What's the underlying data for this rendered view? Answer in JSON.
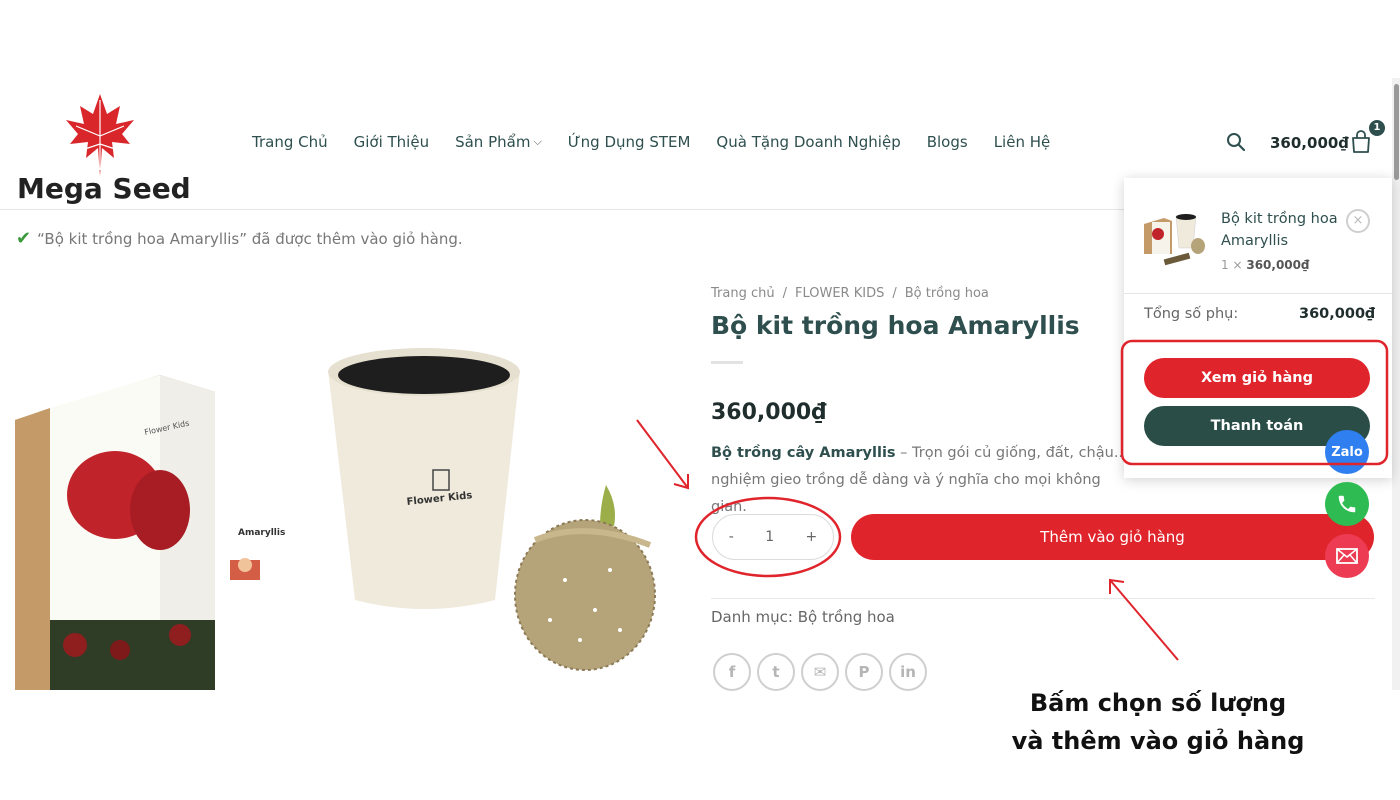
{
  "header": {
    "logo_text": "Mega Seed",
    "nav": [
      {
        "label": "Trang Chủ"
      },
      {
        "label": "Giới Thiệu"
      },
      {
        "label": "Sản Phẩm",
        "has_dropdown": true
      },
      {
        "label": "Ứng Dụng STEM"
      },
      {
        "label": "Quà Tặng Doanh Nghiệp"
      },
      {
        "label": "Blogs"
      },
      {
        "label": "Liên Hệ"
      }
    ],
    "cart_total": "360,000₫",
    "cart_count": "1",
    "icons": [
      "search-icon",
      "cart-icon",
      "chevron-down-icon"
    ]
  },
  "notice": {
    "text": "“Bộ kit trồng hoa Amaryllis” đã được thêm vào giỏ hàng."
  },
  "product": {
    "breadcrumb": [
      "Trang chủ",
      "/",
      "FLOWER KIDS",
      "/",
      "Bộ trồng hoa"
    ],
    "title": "Bộ kit trồng hoa Amaryllis",
    "price": "360,000₫",
    "desc_bold": "Bộ trồng cây Amaryllis",
    "desc_rest": " – Trọn gói củ giống, đất, chậu... nghiệm gieo trồng dễ dàng và ý nghĩa cho mọi không gian.",
    "image_labels": {
      "pot_brand": "Flower Kids",
      "box_brand": "Flower Kids",
      "box_name": "Amaryllis"
    },
    "qty": {
      "minus": "-",
      "value": "1",
      "plus": "+"
    },
    "add_to_cart": "Thêm vào giỏ hàng",
    "category_label": "Danh mục:",
    "category_value": "Bộ trồng hoa",
    "share": [
      {
        "icon": "facebook-icon",
        "glyph": "f"
      },
      {
        "icon": "twitter-icon",
        "glyph": "t"
      },
      {
        "icon": "email-icon",
        "glyph": "✉"
      },
      {
        "icon": "pinterest-icon",
        "glyph": "P"
      },
      {
        "icon": "linkedin-icon",
        "glyph": "in"
      }
    ]
  },
  "minicart": {
    "item_name": "Bộ kit trồng hoa Amaryllis",
    "item_qty_prefix": "1 ×",
    "item_price": "360,000₫",
    "remove": "×",
    "subtotal_label": "Tổng số phụ:",
    "subtotal_value": "360,000₫",
    "view_cart": "Xem giỏ hàng",
    "checkout": "Thanh toán"
  },
  "floating": {
    "zalo": "Zalo",
    "icons": [
      "zalo-icon",
      "phone-icon",
      "mail-icon"
    ]
  },
  "annotation": {
    "line1": "Bấm chọn số lượng",
    "line2": "và thêm vào giỏ hàng",
    "color": "#e0242b"
  },
  "colors": {
    "brand_red": "#e0242b",
    "brand_green": "#2a4d47",
    "text_dark": "#2f4f4f"
  }
}
